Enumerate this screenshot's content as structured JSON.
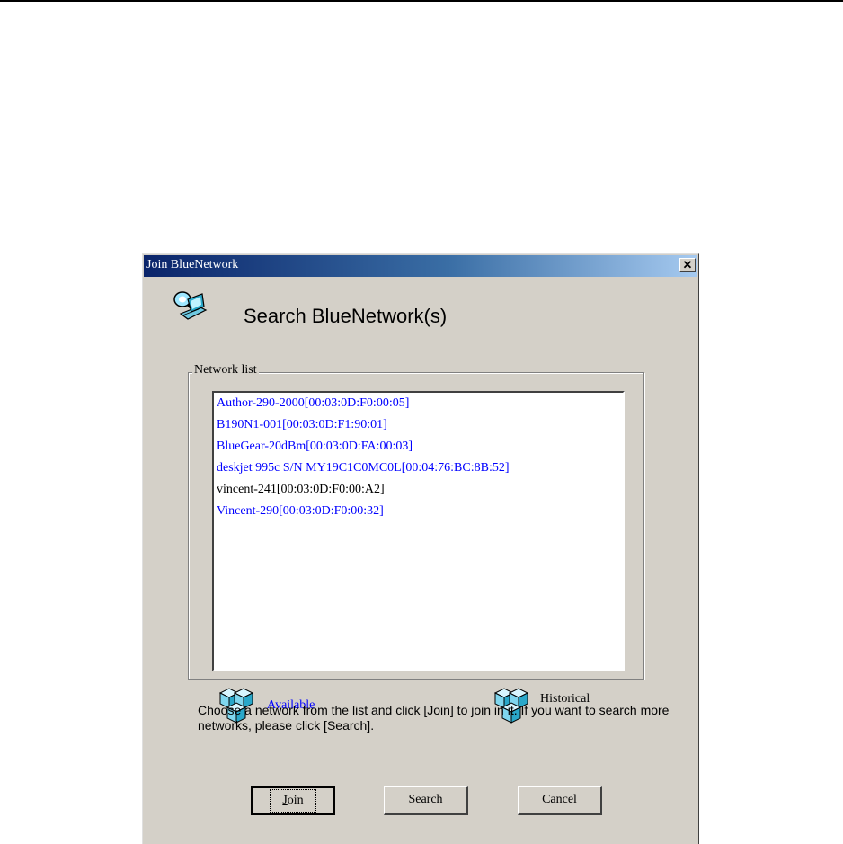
{
  "window": {
    "title": "Join BlueNetwork",
    "close_glyph": "✕",
    "close_icon": "close-icon"
  },
  "header": {
    "title": "Search BlueNetwork(s)",
    "icon": "search-network-icon"
  },
  "network_list": {
    "label": "Network list",
    "items": [
      {
        "text": "Author-290-2000[00:03:0D:F0:00:05]",
        "status": "available"
      },
      {
        "text": "B190N1-001[00:03:0D:F1:90:01]",
        "status": "available"
      },
      {
        "text": "BlueGear-20dBm[00:03:0D:FA:00:03]",
        "status": "available"
      },
      {
        "text": "deskjet 995c S/N MY19C1C0MC0L[00:04:76:BC:8B:52]",
        "status": "available"
      },
      {
        "text": "vincent-241[00:03:0D:F0:00:A2]",
        "status": "historical"
      },
      {
        "text": "Vincent-290[00:03:0D:F0:00:32]",
        "status": "available"
      }
    ]
  },
  "legend": {
    "available": {
      "label": "Available",
      "color": "#0000ff",
      "icon": "network-blocks-icon"
    },
    "historical": {
      "label": "Historical",
      "color": "#000000",
      "icon": "network-blocks-icon"
    }
  },
  "hint": "Choose a network from the list and click [Join] to join in it. If you want to search more networks, please click [Search].",
  "buttons": {
    "join": {
      "label": "Join",
      "accel": "J"
    },
    "search": {
      "label": "Search",
      "accel": "S"
    },
    "cancel": {
      "label": "Cancel",
      "accel": "C"
    }
  },
  "colors": {
    "available": "#0000ff",
    "historical": "#000000",
    "dialog_bg": "#d4d0c8",
    "title_bar": "#0a246a"
  }
}
